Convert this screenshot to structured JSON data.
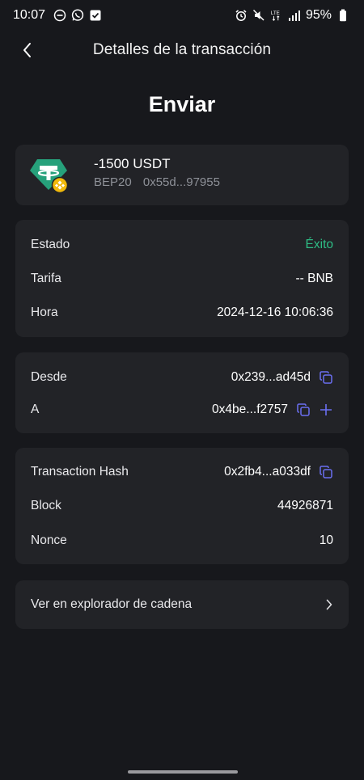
{
  "status_bar": {
    "time": "10:07",
    "battery": "95%",
    "network": "LTE",
    "left_icons": [
      "dnd-icon",
      "whatsapp-icon",
      "check-square-icon"
    ],
    "right_icons": [
      "alarm-icon",
      "mute-icon",
      "lte-icon",
      "signal-icon",
      "battery-icon"
    ]
  },
  "header": {
    "title": "Detalles de la transacción",
    "back_icon": "chevron-left-icon"
  },
  "page_title": "Enviar",
  "token": {
    "amount": "-1500 USDT",
    "network": "BEP20",
    "address": "0x55d...97955",
    "icon": "tether-bnb-icon"
  },
  "status_section": [
    {
      "label": "Estado",
      "value": "Éxito"
    },
    {
      "label": "Tarifa",
      "value": "-- BNB"
    },
    {
      "label": "Hora",
      "value": "2024-12-16 10:06:36"
    }
  ],
  "address_section": [
    {
      "label": "Desde",
      "value": "0x239...ad45d"
    },
    {
      "label": "A",
      "value": "0x4be...f2757"
    }
  ],
  "hash_section": [
    {
      "label": "Transaction Hash",
      "value": "0x2fb4...a033df"
    },
    {
      "label": "Block",
      "value": "44926871"
    },
    {
      "label": "Nonce",
      "value": "10"
    }
  ],
  "explorer": {
    "label": "Ver en explorador de cadena"
  },
  "colors": {
    "background": "#17181c",
    "card": "#222327",
    "success": "#2ebd85",
    "accent": "#6b6ff2",
    "tether": "#26a17b",
    "bnb": "#f0b90b"
  }
}
